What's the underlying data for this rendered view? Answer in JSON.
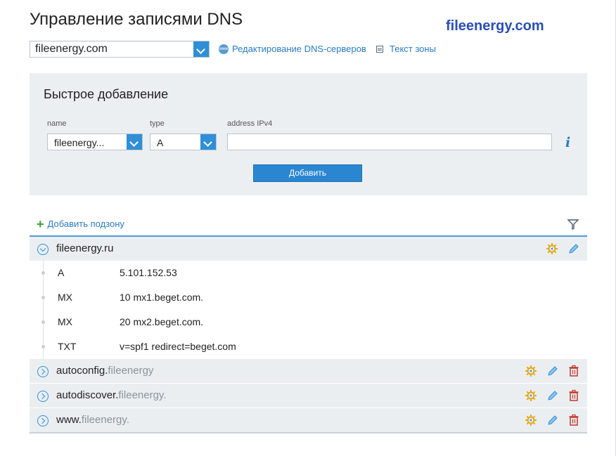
{
  "header": {
    "title": "Управление записями DNS",
    "watermark": "fileenergy.com",
    "domain_selected": "fileenergy.com",
    "link_dns_servers": "Редактирование DNS-серверов",
    "link_zone_text": "Текст зоны"
  },
  "quick_add": {
    "title": "Быстрое добавление",
    "name_label": "name",
    "name_value": "fileenergy...",
    "type_label": "type",
    "type_value": "A",
    "address_label": "address IPv4",
    "address_value": "",
    "info": "i",
    "submit_label": "Добавить"
  },
  "zones": {
    "add_subzone_label": "Добавить подзону",
    "main": {
      "name": "fileenergy.ru",
      "records": [
        {
          "type": "A",
          "value": "5.101.152.53"
        },
        {
          "type": "MX",
          "value": "10 mx1.beget.com."
        },
        {
          "type": "MX",
          "value": "20 mx2.beget.com."
        },
        {
          "type": "TXT",
          "value": "v=spf1 redirect=beget.com"
        }
      ]
    },
    "subzones": [
      {
        "sub": "autoconfig.",
        "domain": "fileenergy"
      },
      {
        "sub": "autodiscover.",
        "domain": "fileenergy."
      },
      {
        "sub": "www.",
        "domain": "fileenergy."
      }
    ]
  },
  "icons": {
    "accent": "#2f8fd8",
    "delete_color": "#c0392b",
    "settings_color": "#e6a817"
  }
}
